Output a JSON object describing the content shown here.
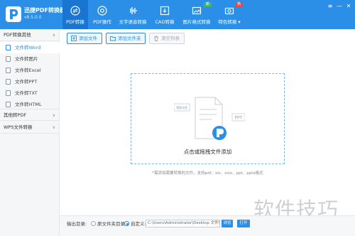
{
  "app": {
    "title": "迅捷PDF转换器",
    "version": "v8.5.0.0"
  },
  "nav": [
    {
      "label": "PDF转换",
      "icon": "swap-icon",
      "active": true
    },
    {
      "label": "PDF操作",
      "icon": "settings-circle-icon",
      "active": false
    },
    {
      "label": "文字语音转换",
      "icon": "audio-wave-icon",
      "active": false
    },
    {
      "label": "CAD转换",
      "icon": "cad-download-icon",
      "active": false
    },
    {
      "label": "图片格式转换",
      "icon": "image-icon",
      "active": false,
      "badge": "新"
    },
    {
      "label": "特色转换",
      "icon": "camera-icon",
      "active": false,
      "badge": "热",
      "has_dropdown": true
    }
  ],
  "sidebar": {
    "groups": [
      {
        "label": "PDF转换其他",
        "expanded": true,
        "items": [
          {
            "label": "文件转Word",
            "active": true
          },
          {
            "label": "文件转图片",
            "active": false
          },
          {
            "label": "文件转Excel",
            "active": false
          },
          {
            "label": "文件转PPT",
            "active": false
          },
          {
            "label": "文件转TXT",
            "active": false
          },
          {
            "label": "文件转HTML",
            "active": false
          }
        ]
      },
      {
        "label": "其他转PDF",
        "expanded": false
      },
      {
        "label": "WPS文件转换",
        "expanded": false
      }
    ]
  },
  "toolbar": {
    "add_file": "添加文件",
    "add_folder": "添加文件夹",
    "clear_list": "清空列表"
  },
  "dropzone": {
    "text": "点击或拖拽文件添加",
    "hint": "*需添加需要转换的文件，支持pdf、xls、xlsx、ppt、pptx格式",
    "doc_labels": [
      "Word",
      "PPT"
    ]
  },
  "output": {
    "label": "输出目录:",
    "option_original": "原文件夹目录",
    "option_custom": "自定义:",
    "selected": "custom",
    "path": "C:\\Users\\Administrator\\Desktop 文件转换",
    "browse": "浏览",
    "open": "打开"
  },
  "watermark": "软件技巧",
  "colors": {
    "primary": "#2b8fe8",
    "nav_active": "#1875d1",
    "badge_new": "#3dbb52",
    "badge_hot": "#f0453a"
  }
}
